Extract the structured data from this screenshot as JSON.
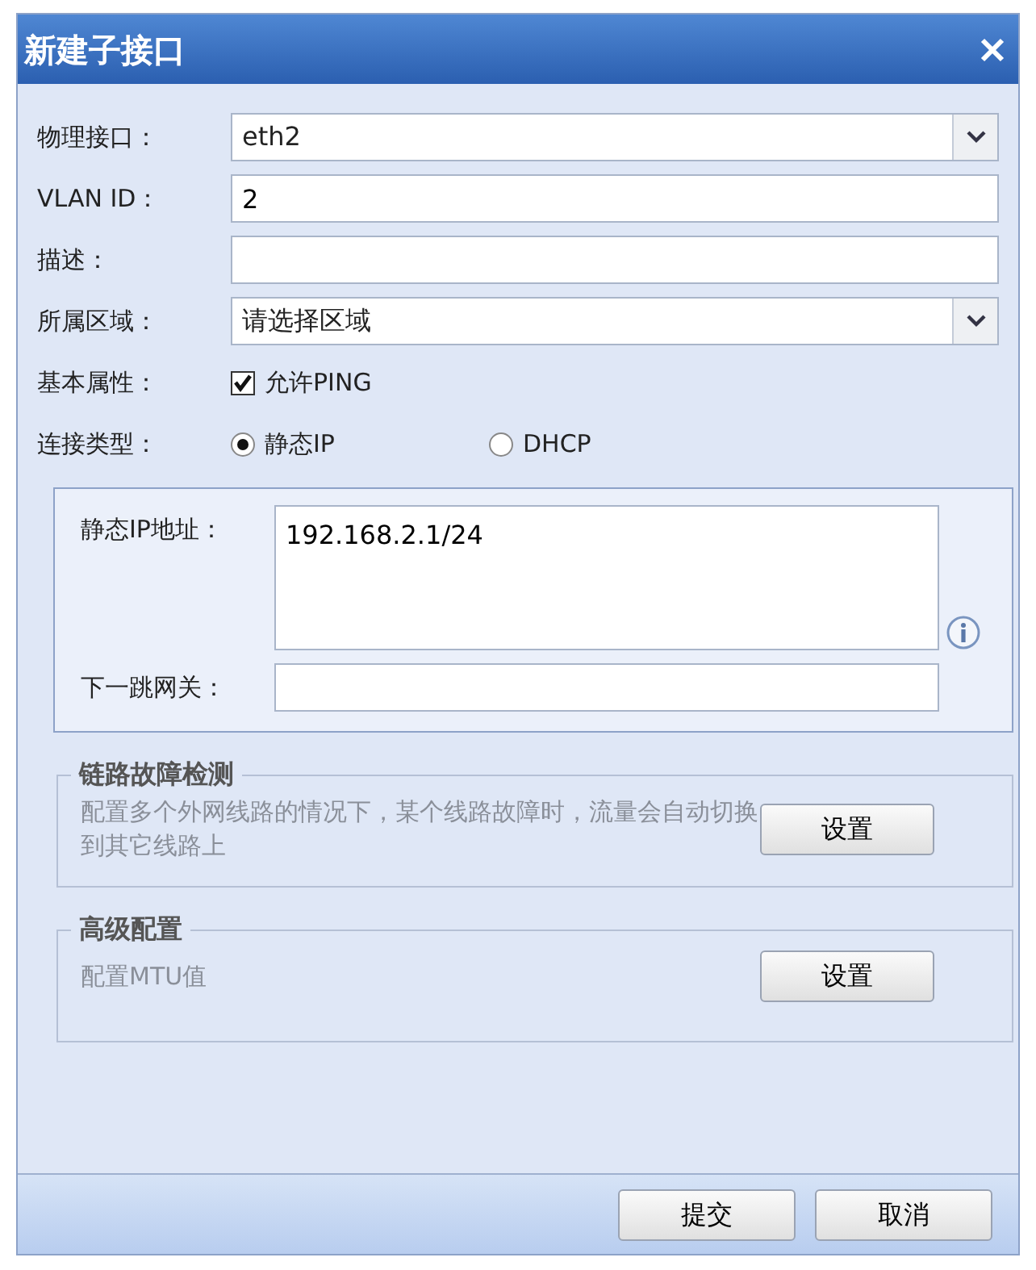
{
  "window": {
    "title": "新建子接口"
  },
  "fields": [
    {
      "kind": "select",
      "label": "物理接口：",
      "value": "eth2"
    },
    {
      "kind": "text",
      "label": "VLAN ID：",
      "value": "2"
    },
    {
      "kind": "text",
      "label": "描述："
    },
    {
      "kind": "select",
      "label": "所属区域：",
      "value": "请选择区域"
    },
    {
      "kind": "checkbox",
      "label": "基本属性：",
      "option": "允许PING",
      "checked": true
    },
    {
      "kind": "radio",
      "label": "连接类型：",
      "options": [
        {
          "label": "静态IP",
          "selected": true
        },
        {
          "label": "DHCP",
          "selected": false
        }
      ]
    }
  ],
  "static_panel": {
    "ip_label": "静态IP地址：",
    "ip_value": "192.168.2.1/24",
    "gateway_label": "下一跳网关："
  },
  "groups": [
    {
      "title": "链路故障检测",
      "description": "配置多个外网线路的情况下，某个线路故障时，流量会自动切换到其它线路上",
      "button": "设置"
    },
    {
      "title": "高级配置",
      "description": "配置MTU值",
      "button": "设置"
    }
  ],
  "buttons": [
    "提交",
    "取消"
  ]
}
